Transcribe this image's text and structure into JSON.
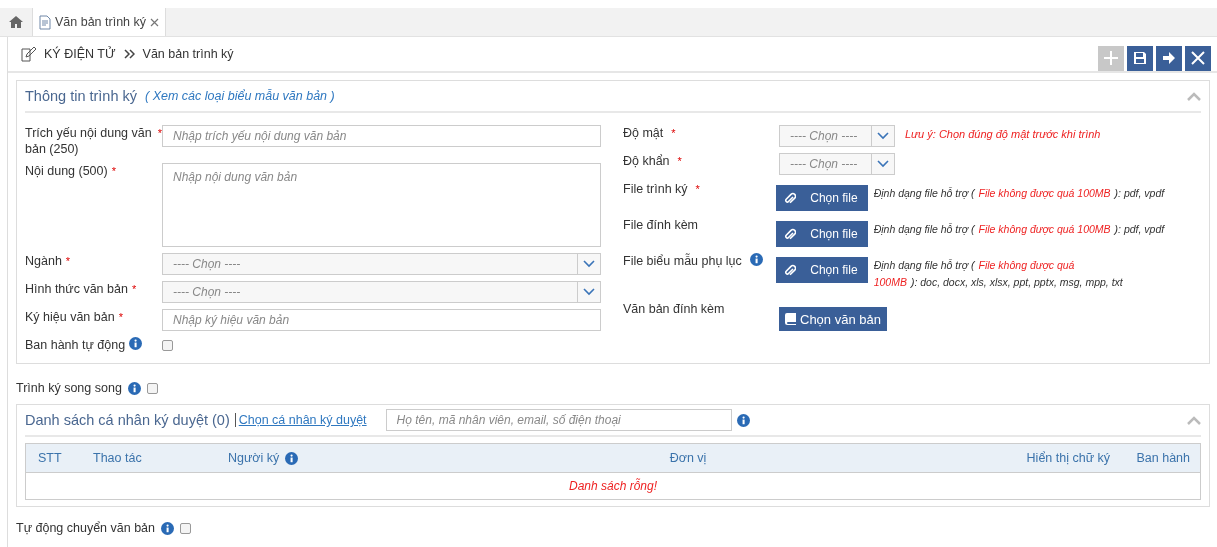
{
  "tabs": [
    {
      "kind": "home",
      "selected": false
    },
    {
      "kind": "document",
      "label": "Văn bản trình ký",
      "selected": true,
      "closable": true
    }
  ],
  "breadcrumb": {
    "items": [
      "KÝ ĐIỆN TỬ",
      "Văn bản trình ký"
    ]
  },
  "toolbar": [
    {
      "kind": "add",
      "disabled": true
    },
    {
      "kind": "save",
      "disabled": false
    },
    {
      "kind": "next",
      "disabled": false
    },
    {
      "kind": "close",
      "disabled": false
    }
  ],
  "info_panel": {
    "title": "Thông tin trình ký",
    "link": "( Xem các loại biểu mẫu văn bản )",
    "left_fields": [
      {
        "kind": "text",
        "label": "Trích yếu nội dung văn bản  (250)",
        "required_mark": "*",
        "placeholder": "Nhập trích yếu nội dung văn bản"
      },
      {
        "kind": "textarea",
        "label": "Nội dung  (500)",
        "required_mark": "*",
        "placeholder": "Nhập nội dung văn bản"
      },
      {
        "kind": "select",
        "label": "Ngành",
        "required_mark": "*",
        "placeholder": "---- Chọn ----"
      },
      {
        "kind": "select",
        "label": "Hình thức văn bản",
        "required_mark": "*",
        "placeholder": "---- Chọn ----"
      },
      {
        "kind": "text",
        "label": "Ký hiệu văn bản",
        "required_mark": "*",
        "placeholder": "Nhập ký hiệu văn bản"
      },
      {
        "kind": "checkbox",
        "label": "Ban hành tự động",
        "info": true,
        "checked": false
      }
    ],
    "right_fields": [
      {
        "kind": "select",
        "label": "Độ mật",
        "required_mark": "*",
        "placeholder": "---- Chọn ----",
        "note": "Lưu ý: Chọn đúng độ mật trước khi trình"
      },
      {
        "kind": "select",
        "label": "Độ khẩn",
        "required_mark": "*",
        "placeholder": "---- Chọn ----"
      },
      {
        "kind": "file",
        "label": "File trình ký",
        "required_mark": "*",
        "button": "Chọn file",
        "hint": "Định dạng file hỗ trợ (",
        "limit": "File không được quá 100MB",
        "formats": "): pdf, vpdf"
      },
      {
        "kind": "file",
        "label": "File đính kèm",
        "button": "Chọn file",
        "hint": "Định dạng file hỗ trợ (",
        "limit": "File không được quá 100MB",
        "formats": "): pdf, vpdf"
      },
      {
        "kind": "file",
        "label": "File biểu mẫu phụ lục",
        "info": true,
        "button": "Chọn file",
        "hint": "Định dạng file hỗ trợ (",
        "limit": "File không được quá 100MB",
        "formats": "): doc, docx, xls, xlsx, ppt, pptx, msg, mpp, txt"
      },
      {
        "kind": "document",
        "label": "Văn bản đính kèm",
        "button": "Chọn văn bản"
      }
    ]
  },
  "parallel_option": {
    "label": "Trình ký song song",
    "info": true,
    "checked": false
  },
  "approvers_panel": {
    "title": "Danh sách cá nhân ký duyệt (0)",
    "link": "Chọn cá nhân ký duyệt",
    "search": {
      "placeholder": "Họ tên, mã nhân viên, email, số điện thoại"
    },
    "info": true,
    "columns": [
      {
        "label": "STT"
      },
      {
        "label": "Thao tác"
      },
      {
        "label": "Người ký",
        "info": true
      },
      {
        "label": "Đơn vị"
      },
      {
        "label": "Hiển thị chữ ký"
      },
      {
        "label": "Ban hành"
      }
    ],
    "empty_message": "Danh sách rỗng!"
  },
  "auto_forward_option": {
    "label": "Tự động chuyển văn bản",
    "info": true,
    "checked": false
  }
}
